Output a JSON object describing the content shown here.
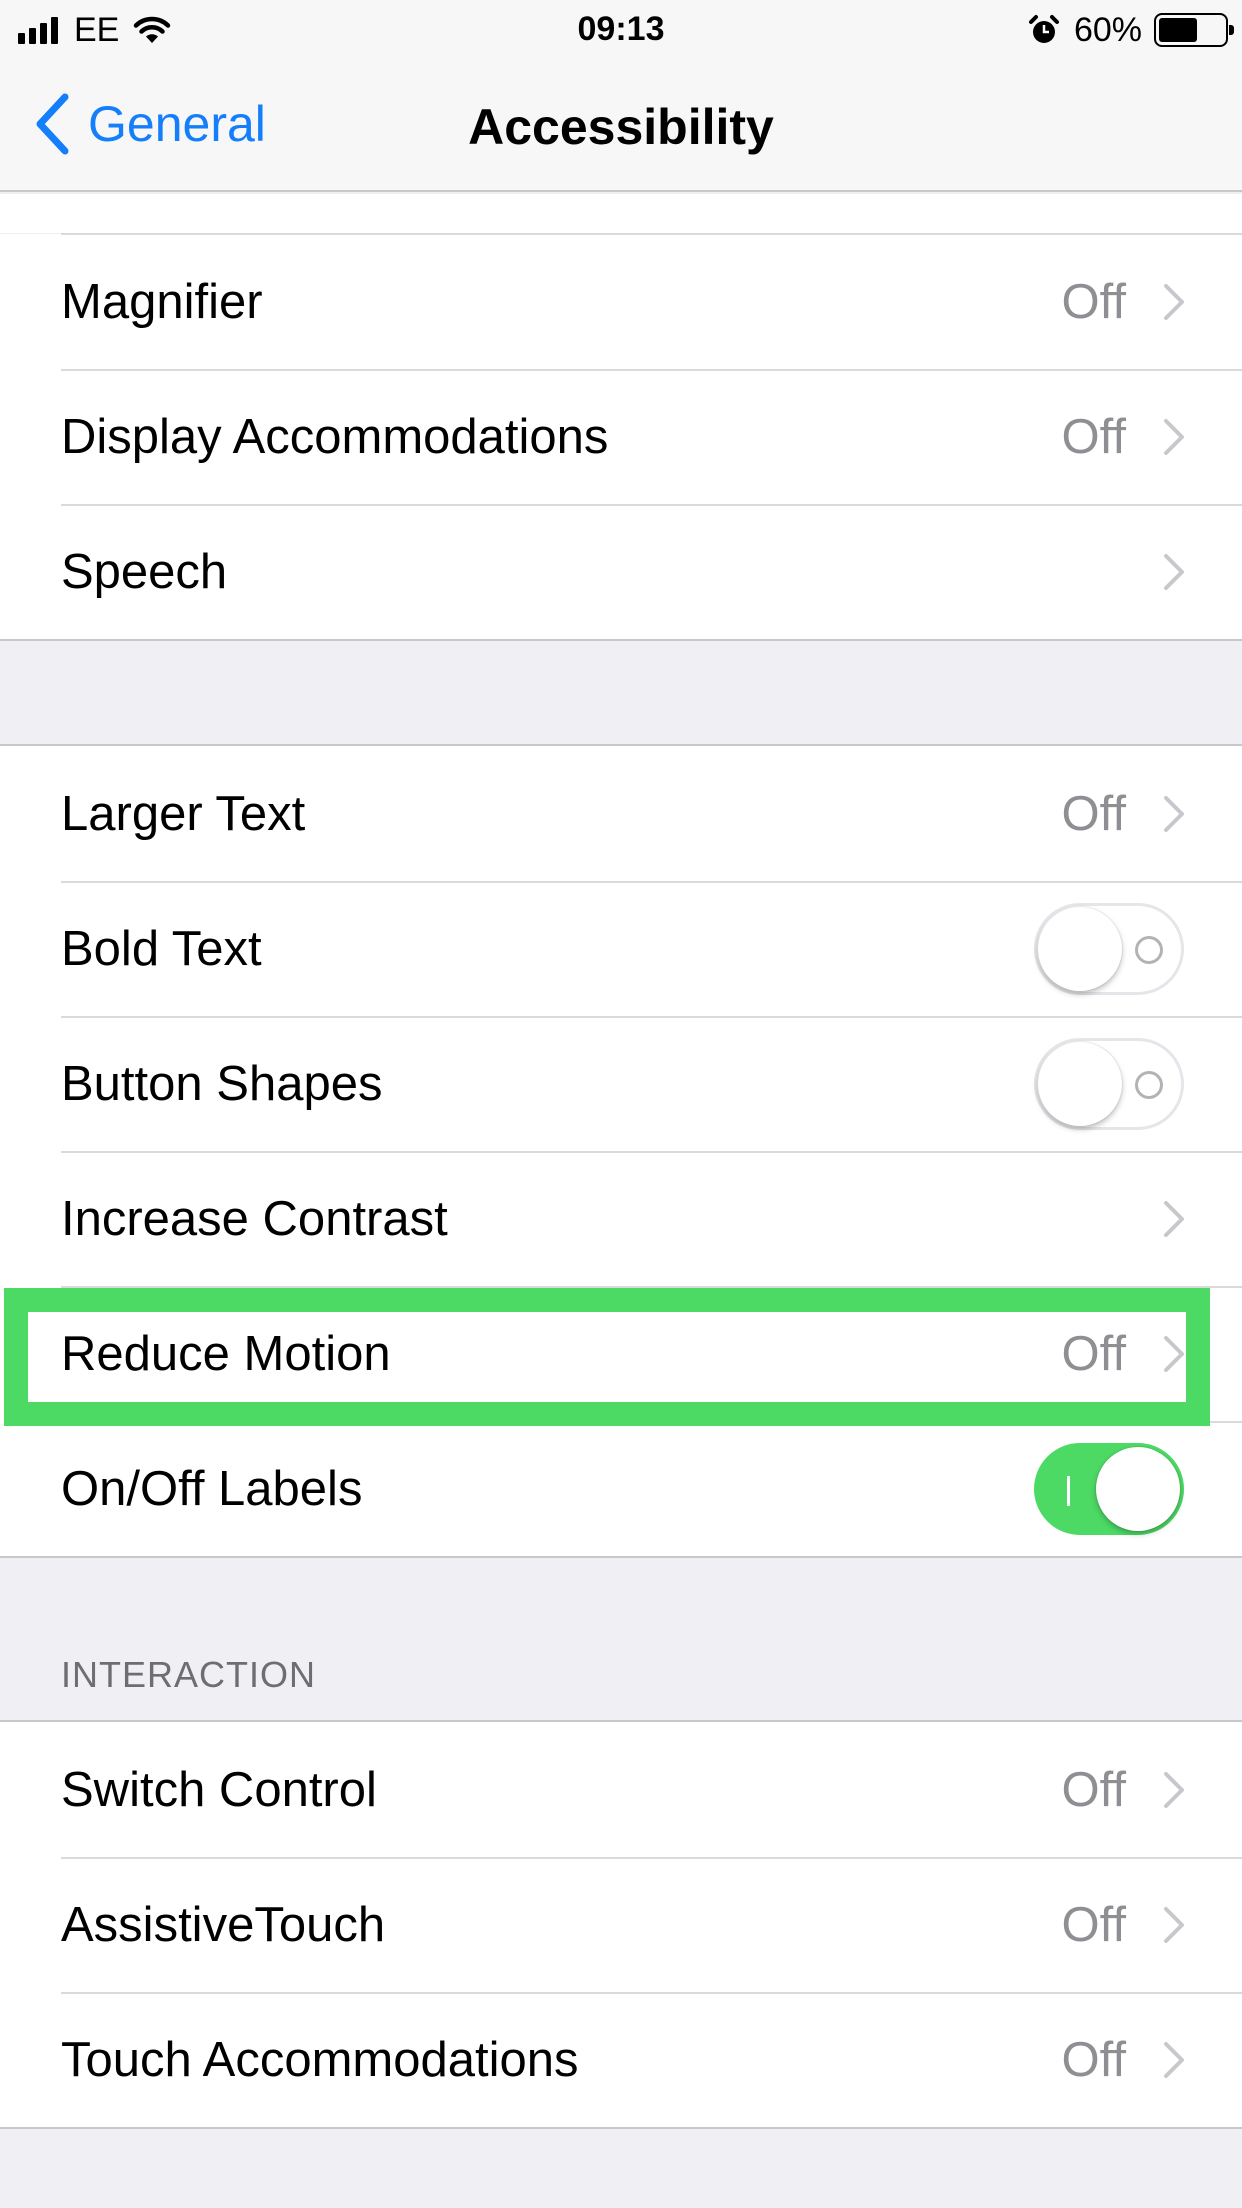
{
  "status_bar": {
    "carrier": "EE",
    "time": "09:13",
    "battery_percent": "60%",
    "battery_level": 0.6,
    "icons": [
      "signal-bars-icon",
      "wifi-icon",
      "alarm-clock-icon",
      "battery-icon"
    ]
  },
  "nav": {
    "back_label": "General",
    "title": "Accessibility"
  },
  "group1": {
    "rows": [
      {
        "label": "Magnifier",
        "value": "Off"
      },
      {
        "label": "Display Accommodations",
        "value": "Off"
      },
      {
        "label": "Speech",
        "value": ""
      }
    ]
  },
  "group2": {
    "rows": [
      {
        "label": "Larger Text",
        "value": "Off"
      },
      {
        "label": "Bold Text",
        "toggle": false
      },
      {
        "label": "Button Shapes",
        "toggle": false
      },
      {
        "label": "Increase Contrast",
        "value": ""
      },
      {
        "label": "Reduce Motion",
        "value": "Off",
        "highlighted": true
      },
      {
        "label": "On/Off Labels",
        "toggle": true
      }
    ]
  },
  "interaction": {
    "header": "INTERACTION",
    "rows": [
      {
        "label": "Switch Control",
        "value": "Off"
      },
      {
        "label": "AssistiveTouch",
        "value": "Off"
      },
      {
        "label": "Touch Accommodations",
        "value": "Off"
      }
    ]
  },
  "colors": {
    "accent_blue": "#157efb",
    "toggle_on_green": "#4cd964",
    "highlight_green": "#4cd964",
    "grouped_background": "#efeff4"
  }
}
